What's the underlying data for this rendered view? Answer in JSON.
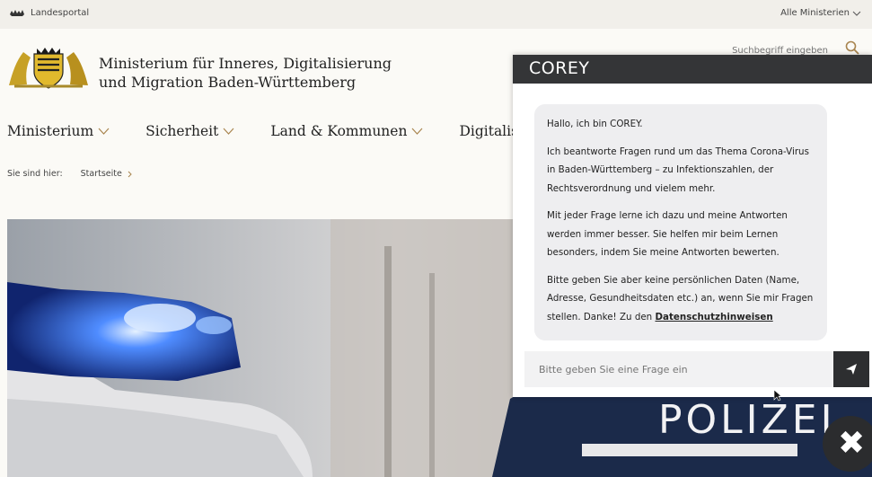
{
  "topbar": {
    "portal_label": "Landesportal",
    "ministries_label": "Alle Ministerien"
  },
  "search": {
    "placeholder": "Suchbegriff eingeben"
  },
  "header": {
    "title_line1": "Ministerium für Inneres, Digitalisierung",
    "title_line2": "und Migration Baden-Württemberg"
  },
  "nav": {
    "items": [
      {
        "label": "Ministerium"
      },
      {
        "label": "Sicherheit"
      },
      {
        "label": "Land & Kommunen"
      },
      {
        "label": "Digitalisierung"
      }
    ]
  },
  "breadcrumb": {
    "prefix": "Sie sind hier:",
    "home": "Startseite"
  },
  "hero": {
    "vest_text": "POLIZEI"
  },
  "chat": {
    "title": "COREY",
    "greeting": "Hallo, ich bin COREY.",
    "paragraph1": "Ich beantworte Fragen rund um das Thema Corona-Virus in Baden-Württemberg – zu Infektionszahlen, der Rechtsverordnung und vielem mehr.",
    "paragraph2": "Mit jeder Frage lerne ich dazu und meine Antworten werden immer besser. Sie helfen mir beim Lernen besonders, indem Sie meine Antworten bewerten.",
    "paragraph3": "Bitte geben Sie aber keine persönlichen Daten (Name, Adresse, Gesundheitsdaten etc.) an, wenn Sie mir Fragen stellen. Danke! Zu den",
    "privacy_link": "Datenschutzhinweisen",
    "input_placeholder": "Bitte geben Sie eine Frage ein",
    "close_symbol": "✖"
  },
  "colors": {
    "chat_header": "#343537",
    "bubble": "#eeeef0",
    "send_button": "#2d2e30",
    "page_bg": "#fbfaf6"
  }
}
